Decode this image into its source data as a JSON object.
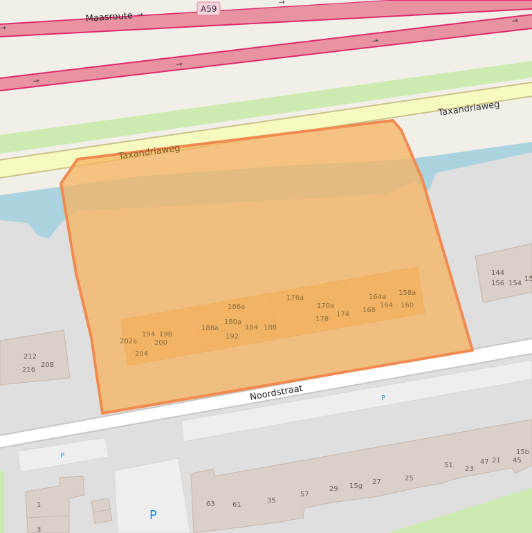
{
  "roads": {
    "motorway_name": "Maasroute",
    "motorway_ref": "A59",
    "service_road_name": "Taxandriaweg",
    "street_name": "Noordstraat"
  },
  "parking": {
    "small_label": "P",
    "big_label": "P"
  },
  "house_numbers": {
    "inside": [
      "186a",
      "176a",
      "170a",
      "164a",
      "158a",
      "180a",
      "188a",
      "184",
      "188",
      "178",
      "174",
      "168",
      "164",
      "160",
      "192",
      "194",
      "198",
      "202a",
      "200",
      "204"
    ],
    "right": [
      "144",
      "156",
      "154",
      "15"
    ],
    "left": [
      "212",
      "216",
      "208"
    ],
    "south": [
      "63",
      "61",
      "35",
      "57",
      "29",
      "15g",
      "27",
      "25",
      "51",
      "23",
      "47",
      "21",
      "45",
      "15b"
    ],
    "southwest": [
      "1",
      "3"
    ]
  },
  "colors": {
    "background": "#f2efe9",
    "motorway": "#e892a2",
    "motorway_casing": "#dc2a67",
    "service_road": "#f7fabf",
    "grass": "#cdebb0",
    "water": "#aad3df",
    "landuse_residential": "#e0dfdf",
    "building": "#d9d0c9",
    "building_outline": "#c4b6ab",
    "highlight_fill": "#f5b35d",
    "highlight_outline": "#f08a50"
  }
}
